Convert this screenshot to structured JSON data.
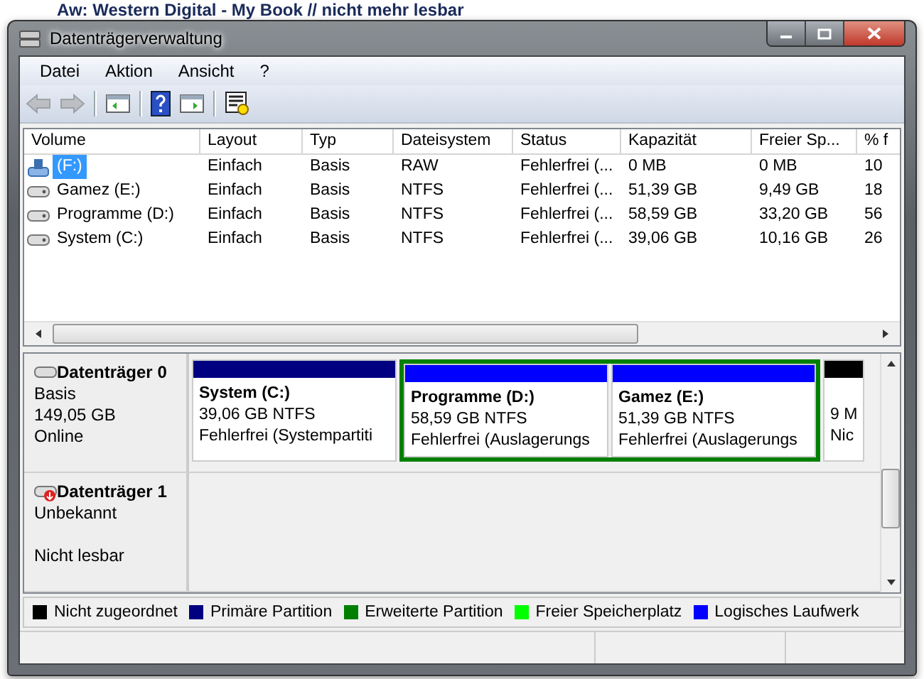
{
  "background_title": "Aw: Western Digital - My Book // nicht mehr lesbar",
  "window": {
    "title": "Datenträgerverwaltung"
  },
  "menu": [
    "Datei",
    "Aktion",
    "Ansicht",
    "?"
  ],
  "toolbar": [
    {
      "kind": "back",
      "disabled": true
    },
    {
      "kind": "forward",
      "disabled": true
    },
    {
      "kind": "sep"
    },
    {
      "kind": "tree"
    },
    {
      "kind": "sep"
    },
    {
      "kind": "help"
    },
    {
      "kind": "pane"
    },
    {
      "kind": "sep"
    },
    {
      "kind": "props"
    }
  ],
  "table": {
    "columns": [
      "Volume",
      "Layout",
      "Typ",
      "Dateisystem",
      "Status",
      "Kapazität",
      "Freier Sp...",
      "% f"
    ],
    "rows": [
      {
        "kind": "removable",
        "selected": true,
        "cells": [
          "(F:)",
          "Einfach",
          "Basis",
          "RAW",
          "Fehlerfrei (...",
          "0 MB",
          "0 MB",
          "10"
        ]
      },
      {
        "kind": "disk",
        "selected": false,
        "cells": [
          "Gamez (E:)",
          "Einfach",
          "Basis",
          "NTFS",
          "Fehlerfrei (...",
          "51,39 GB",
          "9,49 GB",
          "18"
        ]
      },
      {
        "kind": "disk",
        "selected": false,
        "cells": [
          "Programme (D:)",
          "Einfach",
          "Basis",
          "NTFS",
          "Fehlerfrei (...",
          "58,59 GB",
          "33,20 GB",
          "56"
        ]
      },
      {
        "kind": "disk",
        "selected": false,
        "cells": [
          "System (C:)",
          "Einfach",
          "Basis",
          "NTFS",
          "Fehlerfrei (...",
          "39,06 GB",
          "10,16 GB",
          "26"
        ]
      }
    ]
  },
  "disks": [
    {
      "kind": "ok",
      "name": "Datenträger 0",
      "lines": [
        "Basis",
        "149,05 GB",
        "Online"
      ],
      "partitions": [
        {
          "kind": "primary",
          "color": "#000080",
          "title": "System  (C:)",
          "lines": [
            "39,06 GB NTFS",
            "Fehlerfrei (Systempartiti"
          ]
        },
        {
          "kind": "extended",
          "color": "#008000",
          "children": [
            {
              "color": "#0000ff",
              "title": "Programme  (D:)",
              "lines": [
                "58,59 GB NTFS",
                "Fehlerfrei (Auslagerungs"
              ]
            },
            {
              "color": "#0000ff",
              "title": "Gamez  (E:)",
              "lines": [
                "51,39 GB NTFS",
                "Fehlerfrei (Auslagerungs"
              ]
            }
          ]
        },
        {
          "kind": "unallocated",
          "color": "#000000",
          "lines": [
            "9 M",
            "Nic"
          ]
        }
      ]
    },
    {
      "kind": "error",
      "name": "Datenträger 1",
      "lines": [
        "Unbekannt"
      ],
      "state": "Nicht lesbar"
    }
  ],
  "legend": [
    {
      "label": "Nicht zugeordnet",
      "color": "#000000"
    },
    {
      "label": "Primäre Partition",
      "color": "#000080"
    },
    {
      "label": "Erweiterte Partition",
      "color": "#008000"
    },
    {
      "label": "Freier Speicherplatz",
      "color": "#00ff00"
    },
    {
      "label": "Logisches Laufwerk",
      "color": "#0000ff"
    }
  ]
}
